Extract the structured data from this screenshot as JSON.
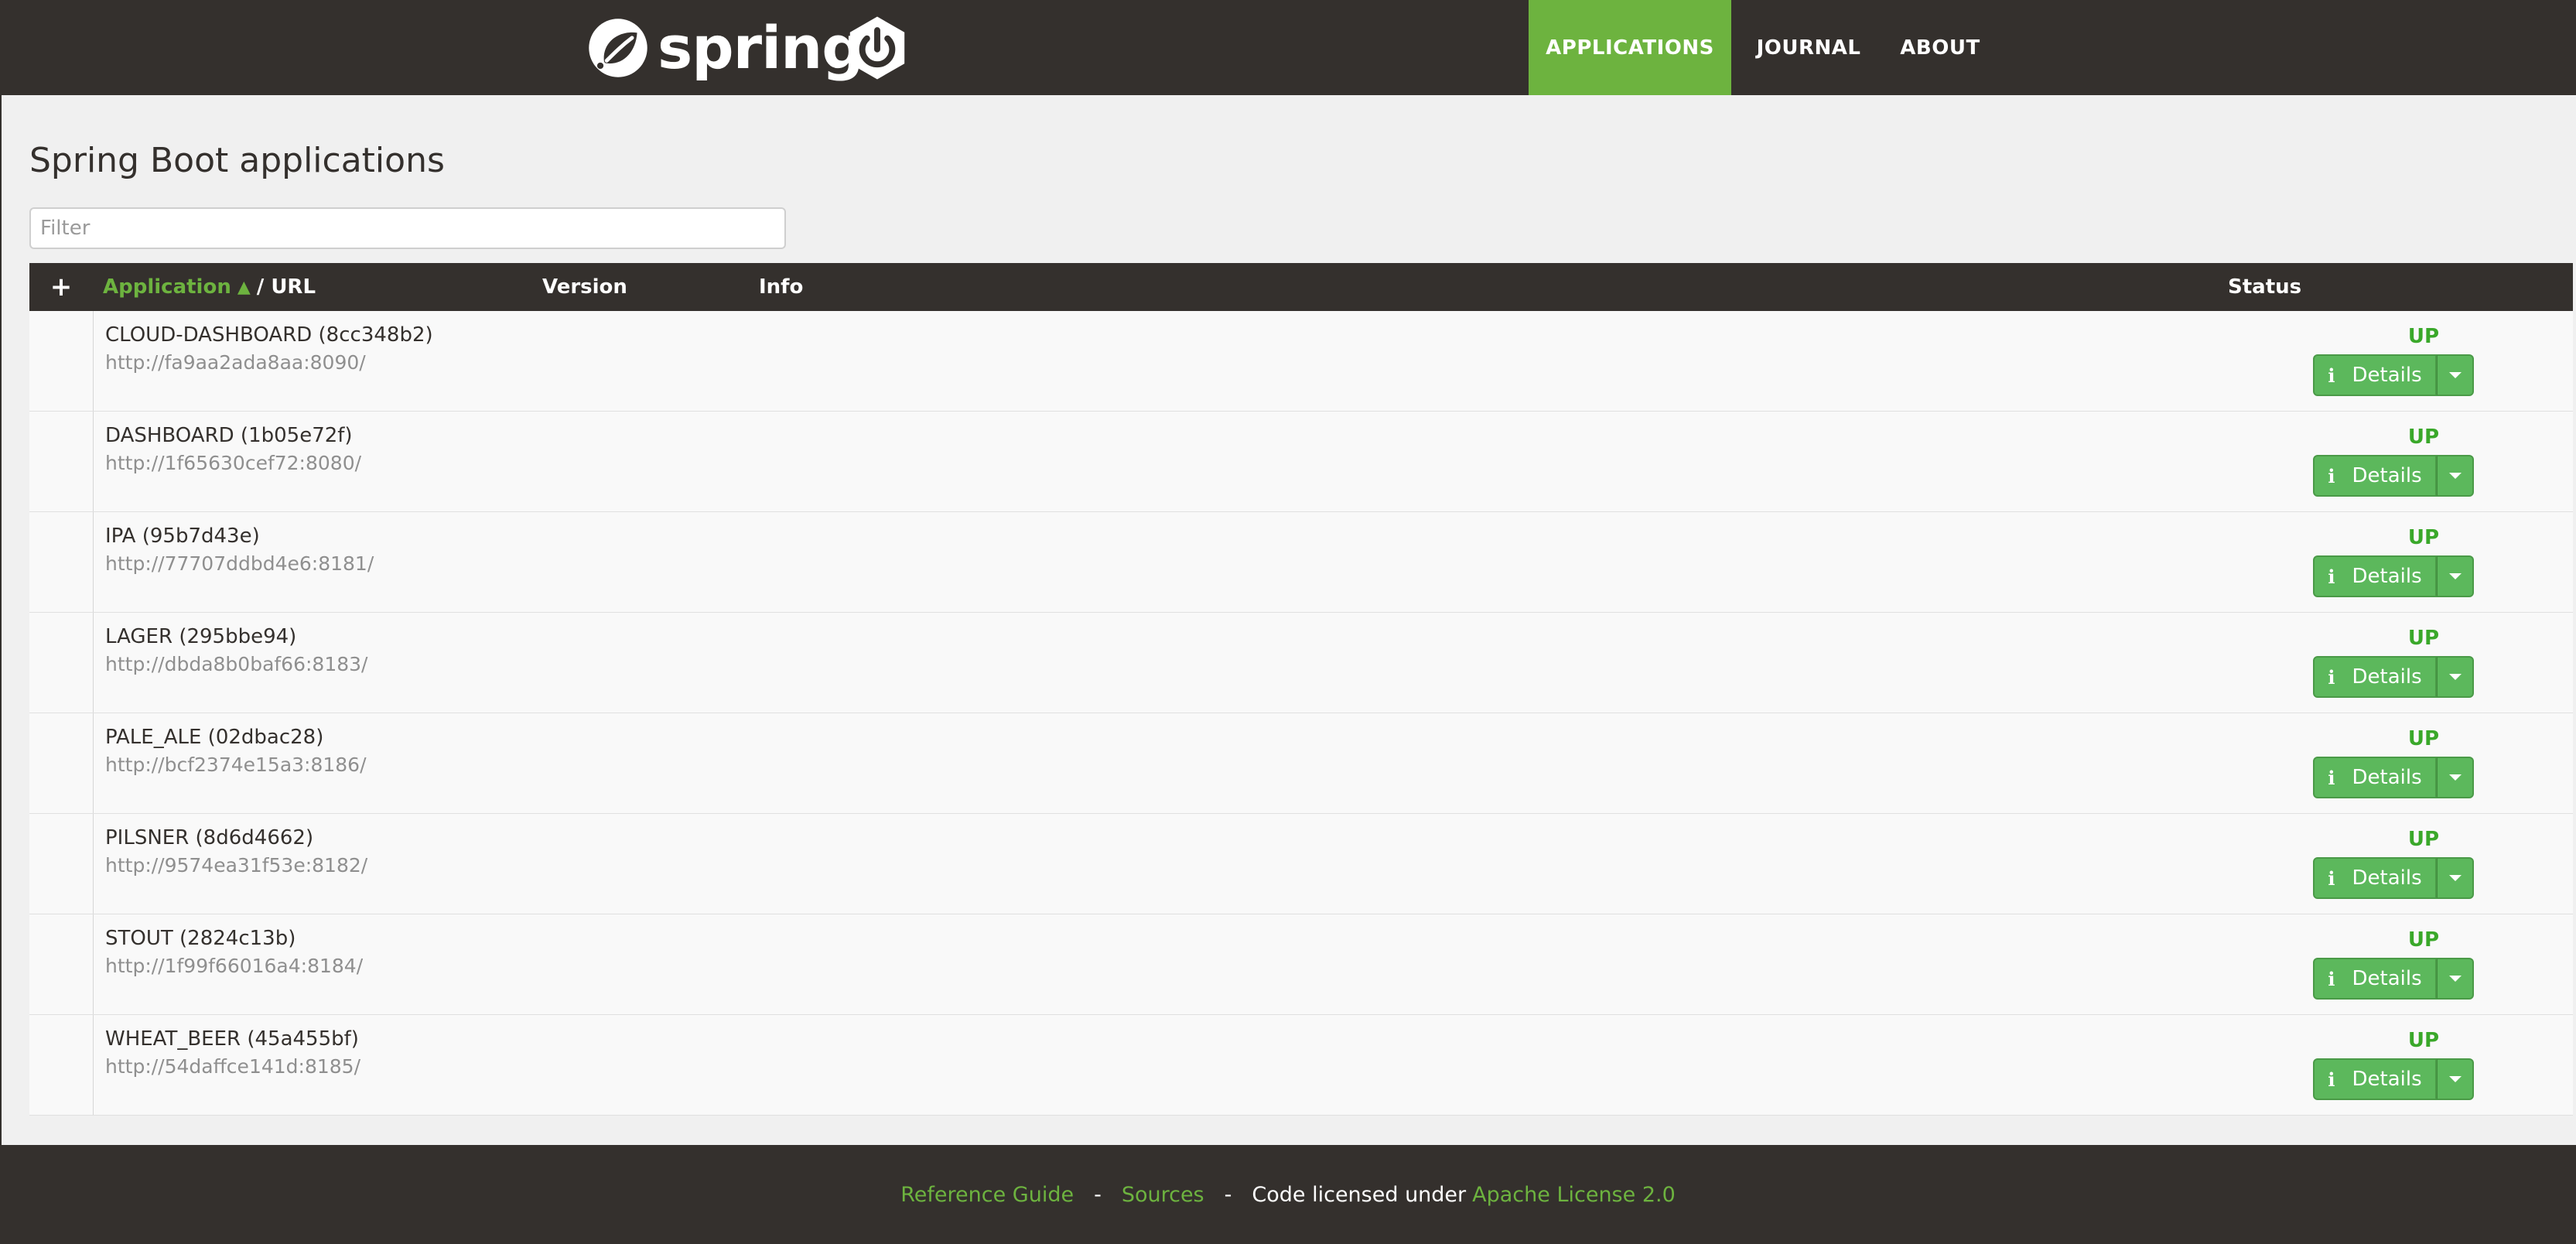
{
  "header": {
    "brand": "spring",
    "nav": [
      {
        "label": "APPLICATIONS",
        "active": true
      },
      {
        "label": "JOURNAL",
        "active": false
      },
      {
        "label": "ABOUT",
        "active": false
      }
    ],
    "accent": "#6db33f",
    "bg": "#34302d"
  },
  "page": {
    "title": "Spring Boot applications",
    "filter_placeholder": "Filter"
  },
  "table": {
    "headers": {
      "plus": "+",
      "application": "Application",
      "url": "/ URL",
      "version": "Version",
      "info": "Info",
      "status": "Status"
    },
    "rows": [
      {
        "name": "CLOUD-DASHBOARD (8cc348b2)",
        "url": "http://fa9aa2ada8aa:8090/",
        "status": "UP",
        "details": "Details"
      },
      {
        "name": "DASHBOARD (1b05e72f)",
        "url": "http://1f65630cef72:8080/",
        "status": "UP",
        "details": "Details"
      },
      {
        "name": "IPA (95b7d43e)",
        "url": "http://77707ddbd4e6:8181/",
        "status": "UP",
        "details": "Details"
      },
      {
        "name": "LAGER (295bbe94)",
        "url": "http://dbda8b0baf66:8183/",
        "status": "UP",
        "details": "Details"
      },
      {
        "name": "PALE_ALE (02dbac28)",
        "url": "http://bcf2374e15a3:8186/",
        "status": "UP",
        "details": "Details"
      },
      {
        "name": "PILSNER (8d6d4662)",
        "url": "http://9574ea31f53e:8182/",
        "status": "UP",
        "details": "Details"
      },
      {
        "name": "STOUT (2824c13b)",
        "url": "http://1f99f66016a4:8184/",
        "status": "UP",
        "details": "Details"
      },
      {
        "name": "WHEAT_BEER (45a455bf)",
        "url": "http://54daffce141d:8185/",
        "status": "UP",
        "details": "Details"
      }
    ]
  },
  "footer": {
    "reference_guide": "Reference Guide",
    "sources": "Sources",
    "license_text": "Code licensed under",
    "license_link": "Apache License 2.0",
    "sep": "-"
  }
}
